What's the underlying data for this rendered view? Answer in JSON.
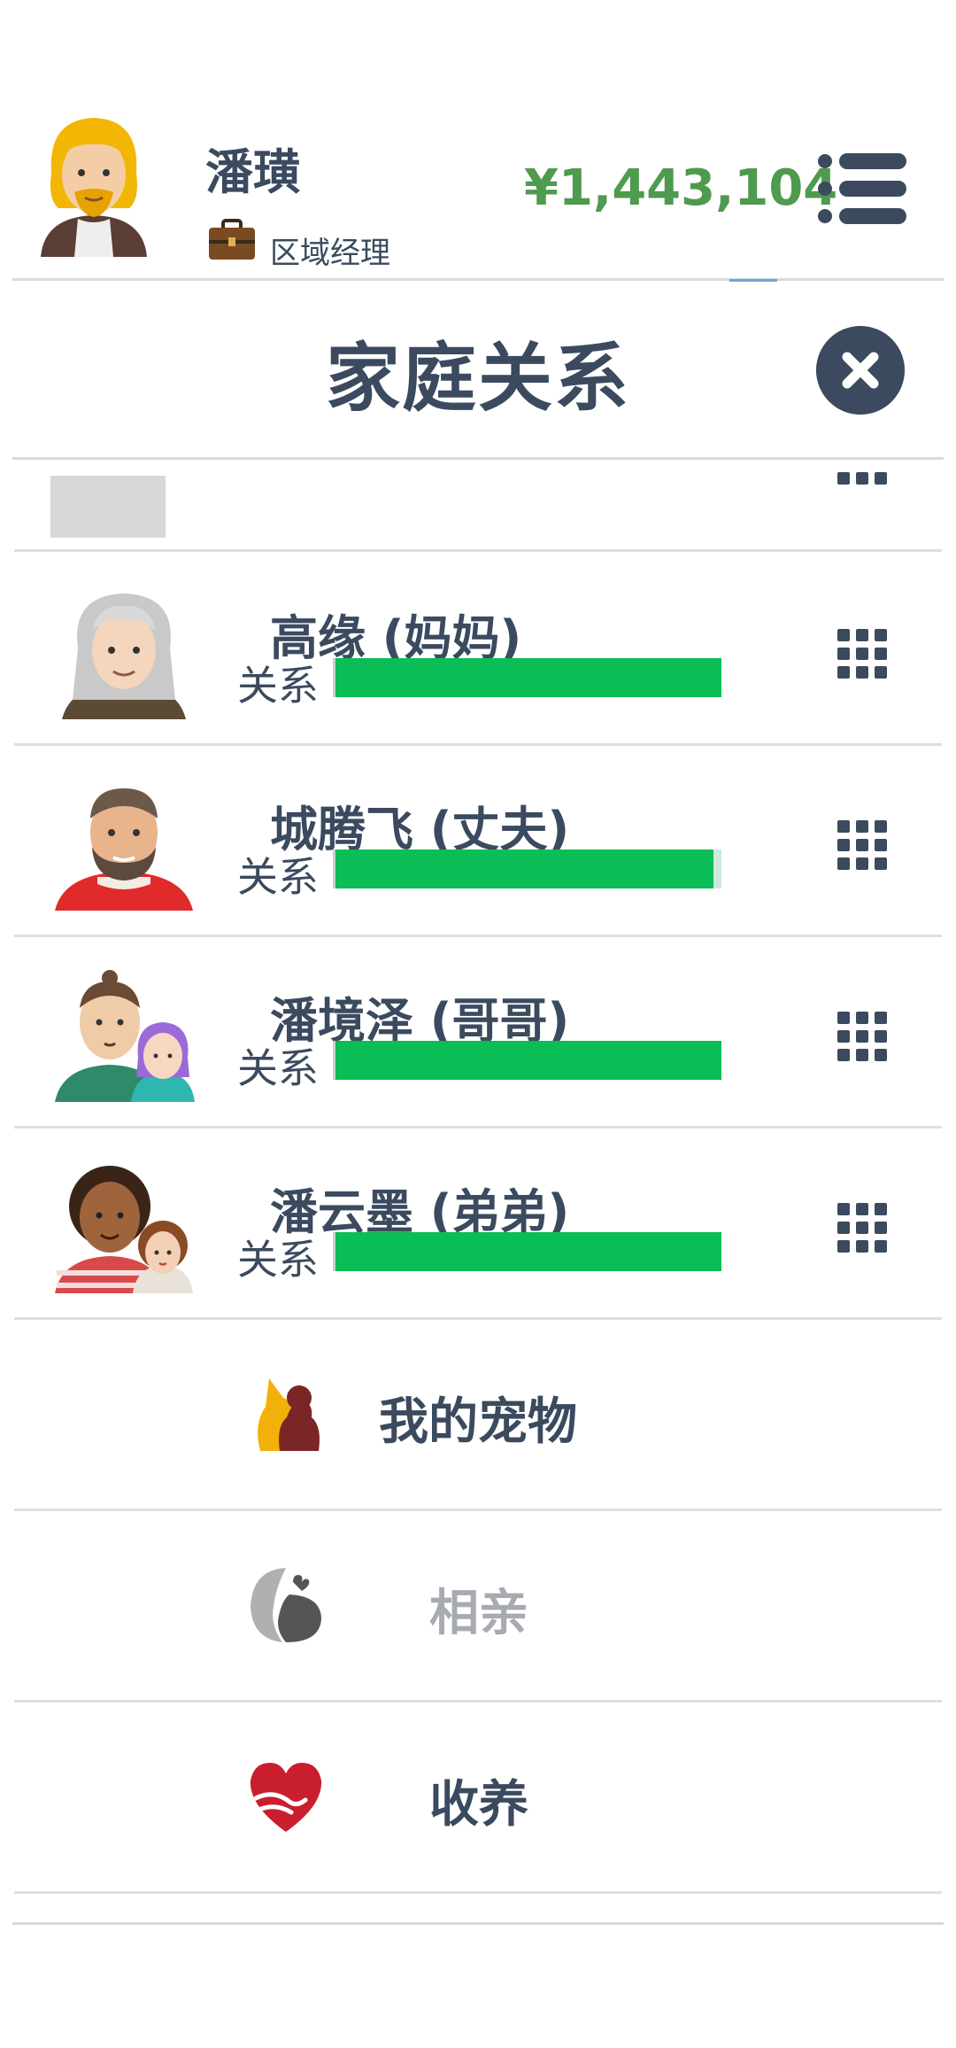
{
  "header": {
    "player_name": "潘璜",
    "job_title": "区域经理",
    "money": "¥1,443,104",
    "avatar": "blonde-bearded-man-avatar",
    "job_icon": "briefcase-icon",
    "menu_icon": "menu-list-icon"
  },
  "panel": {
    "title": "家庭关系",
    "close_icon": "close-icon"
  },
  "family": {
    "relationship_label": "关系",
    "members": [
      {
        "name": "高缘 (妈妈)",
        "relationship": 1.0,
        "avatar": "grey-haired-mother-avatar"
      },
      {
        "name": "城腾飞 (丈夫)",
        "relationship": 0.98,
        "avatar": "bearded-husband-avatar"
      },
      {
        "name": "潘境泽 (哥哥)",
        "relationship": 1.0,
        "avatar": "brother-with-partner-avatar"
      },
      {
        "name": "潘云墨 (弟弟)",
        "relationship": 1.0,
        "avatar": "younger-brother-with-partner-avatar"
      }
    ],
    "options_icon": "grid-menu-icon"
  },
  "actions": [
    {
      "label": "我的宠物",
      "icon": "pet-dog-icon",
      "enabled": true
    },
    {
      "label": "相亲",
      "icon": "matchmaking-faces-icon",
      "enabled": false
    },
    {
      "label": "收养",
      "icon": "heart-hands-icon",
      "enabled": true
    }
  ],
  "colors": {
    "text": "#3b4a5e",
    "money": "#4e9a4e",
    "bar_fill": "#0abd56",
    "divider": "#dcdfe3",
    "disabled": "#a7abb1"
  }
}
